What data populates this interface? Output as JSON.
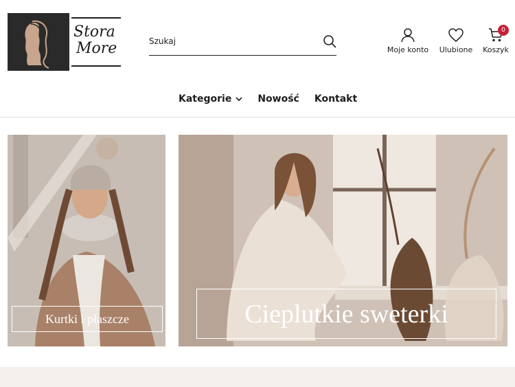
{
  "brand": {
    "line1": "Stora",
    "line2": "More"
  },
  "search": {
    "placeholder": "Szukaj"
  },
  "account": {
    "my_account": "Moje konto",
    "wishlist": "Ulubione",
    "cart": "Koszyk",
    "cart_count": "0"
  },
  "nav": {
    "items": [
      "Kategorie",
      "Nowość",
      "Kontakt"
    ]
  },
  "banners": {
    "left": {
      "label": "Kurtki i płaszcze"
    },
    "right": {
      "label": "Cieplutkie sweterki"
    }
  },
  "colors": {
    "badge": "#c5213a",
    "text": "#1c1c1c",
    "logo_bg": "#2a2a2a"
  }
}
